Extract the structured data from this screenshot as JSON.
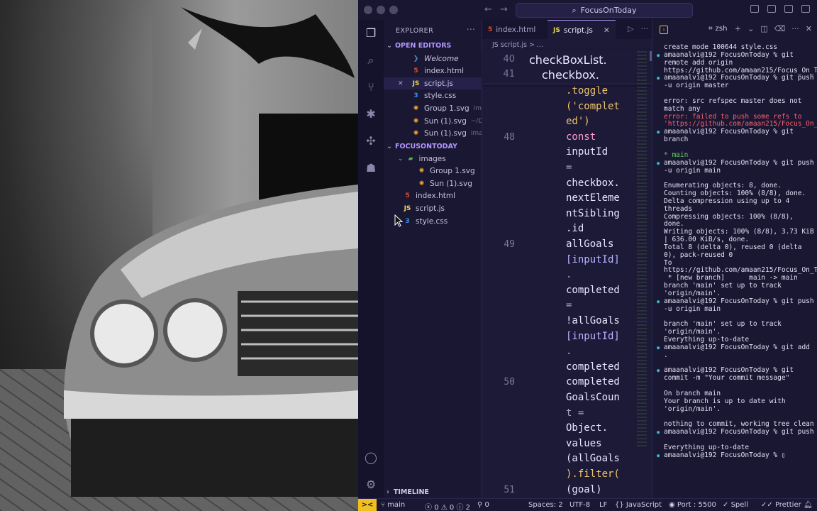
{
  "titlebar": {
    "search_text": "FocusOnToday"
  },
  "explorer": {
    "title": "EXPLORER",
    "open_editors_label": "OPEN EDITORS",
    "open_editors": [
      {
        "icon": "vscode-icon",
        "name": "Welcome",
        "hint": ""
      },
      {
        "icon": "html-file-icon",
        "name": "index.html",
        "hint": ""
      },
      {
        "icon": "js-file-icon",
        "name": "script.js",
        "hint": ""
      },
      {
        "icon": "css-file-icon",
        "name": "style.css",
        "hint": ""
      },
      {
        "icon": "svg-file-icon",
        "name": "Group 1.svg",
        "hint": "im..."
      },
      {
        "icon": "svg-file-icon",
        "name": "Sun (1).svg",
        "hint": "~/D..."
      },
      {
        "icon": "svg-file-icon",
        "name": "Sun (1).svg",
        "hint": "ima..."
      }
    ],
    "folder_label": "FOCUSONTODAY",
    "tree": [
      {
        "icon": "folder-icon",
        "name": "images",
        "level": 1
      },
      {
        "icon": "svg-file-icon",
        "name": "Group 1.svg",
        "level": 2
      },
      {
        "icon": "svg-file-icon",
        "name": "Sun (1).svg",
        "level": 2
      },
      {
        "icon": "html-file-icon",
        "name": "index.html",
        "level": 1
      },
      {
        "icon": "js-file-icon",
        "name": "script.js",
        "level": 1
      },
      {
        "icon": "css-file-icon",
        "name": "style.css",
        "level": 1
      }
    ],
    "timeline_label": "TIMELINE"
  },
  "editor": {
    "tabs": [
      {
        "label": "index.html",
        "icon": "html-file-icon"
      },
      {
        "label": "script.js",
        "icon": "js-file-icon"
      }
    ],
    "breadcrumb": "JS script.js > ...",
    "sticky": [
      {
        "ln": "40",
        "text": "checkBoxList."
      },
      {
        "ln": "41",
        "text": "checkbox."
      }
    ],
    "lines": [
      {
        "ln": "",
        "text": ".toggle"
      },
      {
        "ln": "",
        "text": "('complet"
      },
      {
        "ln": "",
        "text": "ed')"
      },
      {
        "ln": "48",
        "text": "const"
      },
      {
        "ln": "",
        "text": "inputId"
      },
      {
        "ln": "",
        "text": "="
      },
      {
        "ln": "",
        "text": "checkbox."
      },
      {
        "ln": "",
        "text": "nextEleme"
      },
      {
        "ln": "",
        "text": "ntSibling"
      },
      {
        "ln": "",
        "text": ".id"
      },
      {
        "ln": "49",
        "text": "allGoals"
      },
      {
        "ln": "",
        "text": "[inputId]"
      },
      {
        "ln": "",
        "text": "."
      },
      {
        "ln": "",
        "text": "completed"
      },
      {
        "ln": "",
        "text": " ="
      },
      {
        "ln": "",
        "text": "!allGoals"
      },
      {
        "ln": "",
        "text": "[inputId]"
      },
      {
        "ln": "",
        "text": "."
      },
      {
        "ln": "",
        "text": "completed"
      },
      {
        "ln": "50",
        "text": "completed"
      },
      {
        "ln": "",
        "text": "GoalsCoun"
      },
      {
        "ln": "",
        "text": "t ="
      },
      {
        "ln": "",
        "text": "Object."
      },
      {
        "ln": "",
        "text": "values"
      },
      {
        "ln": "",
        "text": "(allGoals"
      },
      {
        "ln": "",
        "text": ").filter("
      },
      {
        "ln": "51",
        "text": " (goal)"
      }
    ]
  },
  "terminal": {
    "shell": "zsh",
    "lines": [
      {
        "t": "create mode 100644 style.css",
        "k": ""
      },
      {
        "t": "amaanalvi@192 FocusOnToday % git remote add origin https://github.com/amaan215/Focus_On_Today.git",
        "k": "prompt"
      },
      {
        "t": "amaanalvi@192 FocusOnToday % git push -u origin master",
        "k": "prompt"
      },
      {
        "t": "",
        "k": "gap"
      },
      {
        "t": "error: src refspec master does not match any",
        "k": ""
      },
      {
        "t": "error: failed to push some refs to 'https://github.com/amaan215/Focus_On_Today.git'",
        "k": "err"
      },
      {
        "t": "amaanalvi@192 FocusOnToday % git branch",
        "k": "prompt"
      },
      {
        "t": "",
        "k": "gap"
      },
      {
        "t": "* main",
        "k": "grn"
      },
      {
        "t": "amaanalvi@192 FocusOnToday % git push -u origin main",
        "k": "prompt"
      },
      {
        "t": "",
        "k": "gap"
      },
      {
        "t": "Enumerating objects: 8, done.",
        "k": ""
      },
      {
        "t": "Counting objects: 100% (8/8), done.",
        "k": ""
      },
      {
        "t": "Delta compression using up to 4 threads",
        "k": ""
      },
      {
        "t": "Compressing objects: 100% (8/8), done.",
        "k": ""
      },
      {
        "t": "Writing objects: 100% (8/8), 3.73 KiB | 636.00 KiB/s, done.",
        "k": ""
      },
      {
        "t": "Total 8 (delta 0), reused 0 (delta 0), pack-reused 0",
        "k": ""
      },
      {
        "t": "To https://github.com/amaan215/Focus_On_Today.git",
        "k": ""
      },
      {
        "t": " * [new branch]      main -> main",
        "k": ""
      },
      {
        "t": "branch 'main' set up to track 'origin/main'.",
        "k": ""
      },
      {
        "t": "amaanalvi@192 FocusOnToday % git push -u origin main",
        "k": "prompt"
      },
      {
        "t": "",
        "k": "gap"
      },
      {
        "t": "branch 'main' set up to track 'origin/main'.",
        "k": ""
      },
      {
        "t": "Everything up-to-date",
        "k": ""
      },
      {
        "t": "amaanalvi@192 FocusOnToday % git add .",
        "k": "prompt"
      },
      {
        "t": "",
        "k": "gap"
      },
      {
        "t": "amaanalvi@192 FocusOnToday % git commit -m \"Your commit message\"",
        "k": "prompt"
      },
      {
        "t": "",
        "k": "gap"
      },
      {
        "t": "On branch main",
        "k": ""
      },
      {
        "t": "Your branch is up to date with 'origin/main'.",
        "k": ""
      },
      {
        "t": "",
        "k": "gap"
      },
      {
        "t": "nothing to commit, working tree clean",
        "k": ""
      },
      {
        "t": "amaanalvi@192 FocusOnToday % git push",
        "k": "prompt"
      },
      {
        "t": "",
        "k": "gap"
      },
      {
        "t": "Everything up-to-date",
        "k": ""
      },
      {
        "t": "amaanalvi@192 FocusOnToday % ▯",
        "k": "prompt"
      }
    ]
  },
  "statusbar": {
    "branch": "main",
    "errors": "0",
    "warnings": "0",
    "info": "2",
    "ports": "0",
    "spaces": "Spaces: 2",
    "encoding": "UTF-8",
    "eol": "LF",
    "language": "JavaScript",
    "port": "Port : 5500",
    "spell": "Spell",
    "prettier": "Prettier"
  },
  "colors": {
    "accent": "#b497ff",
    "remote": "#f0c020",
    "bg": "#1a1733"
  }
}
